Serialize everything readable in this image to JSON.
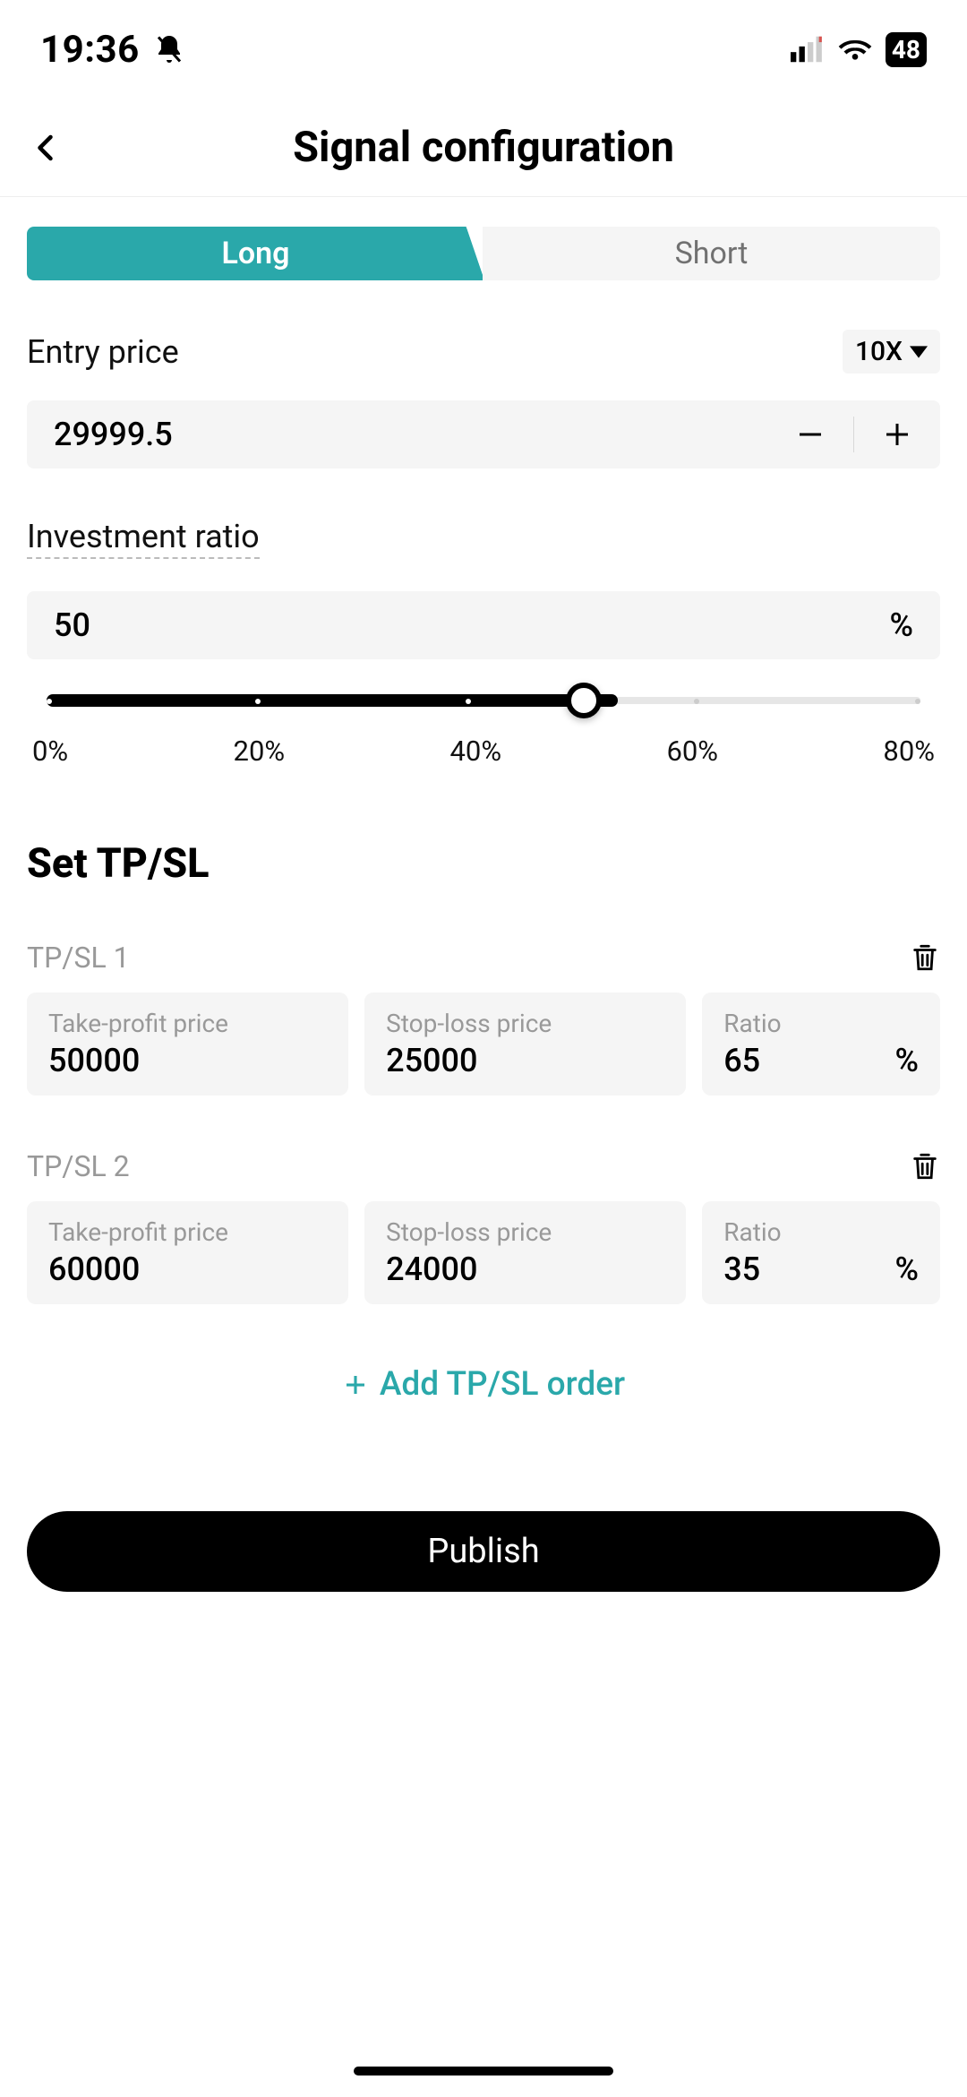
{
  "status_bar": {
    "time": "19:36",
    "battery": "48"
  },
  "header": {
    "title": "Signal configuration"
  },
  "tabs": {
    "long": "Long",
    "short": "Short"
  },
  "entry_price": {
    "label": "Entry price",
    "leverage": "10X",
    "value": "29999.5"
  },
  "investment": {
    "label": "Investment ratio",
    "value": "50",
    "unit": "%",
    "ticks": [
      "0%",
      "20%",
      "40%",
      "60%",
      "80%"
    ]
  },
  "tpsl": {
    "section_title": "Set TP/SL",
    "labels": {
      "tp": "Take-profit price",
      "sl": "Stop-loss price",
      "ratio": "Ratio",
      "unit": "%"
    },
    "rows": [
      {
        "name": "TP/SL 1",
        "tp": "50000",
        "sl": "25000",
        "ratio": "65"
      },
      {
        "name": "TP/SL 2",
        "tp": "60000",
        "sl": "24000",
        "ratio": "35"
      }
    ],
    "add_label": "Add TP/SL order"
  },
  "publish": "Publish"
}
